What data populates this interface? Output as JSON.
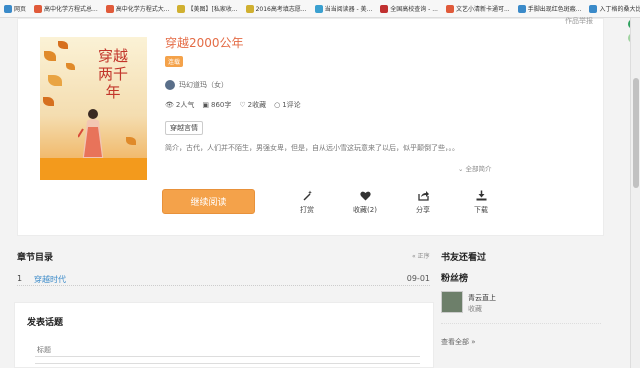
{
  "bookmarks": [
    {
      "label": "网页",
      "color": "#3a8ac9"
    },
    {
      "label": "高中化学方程式总...",
      "color": "#e05a3a"
    },
    {
      "label": "高中化学方程式大...",
      "color": "#e05a3a"
    },
    {
      "label": "【美图】[私家收...",
      "color": "#d0b030"
    },
    {
      "label": "2016高考填志愿...",
      "color": "#d0b030"
    },
    {
      "label": "当当阅读器 - 美...",
      "color": "#3aa0d0"
    },
    {
      "label": "全国高校查询 - ...",
      "color": "#c03030"
    },
    {
      "label": "文艺小清新卡通可...",
      "color": "#e05a3a"
    },
    {
      "label": "手脚出现红色斑瘢...",
      "color": "#3a8ac9"
    },
    {
      "label": "入丁格的桑大比...",
      "color": "#3a8ac9"
    }
  ],
  "book": {
    "report_label": "作品举报",
    "cover_title": "穿越两千年",
    "title": "穿越2000公年",
    "status_tag": "连载",
    "author": "玛幻道玛（女）",
    "popularity": "2人气",
    "word_count": "860字",
    "favorites": "2收藏",
    "comments": "1评论",
    "genre": "穿越言情",
    "intro": "简介，古代，人们并不陌生，男强女卑，但是，自从远小雪这玩意来了以后，似乎颠倒了些，。。",
    "more_intro": "全部简介"
  },
  "actions": {
    "read_label": "继续阅读",
    "tip_label": "打赏",
    "collect_label": "收藏(2)",
    "share_label": "分享",
    "download_label": "下载"
  },
  "chapters": {
    "heading": "章节目录",
    "order_label": "« 正序",
    "items": [
      {
        "num": "1",
        "name": "穿越时代",
        "date": "09-01"
      }
    ]
  },
  "comments": {
    "heading": "发表话题",
    "title_placeholder": "标题"
  },
  "sidebar": {
    "also_read_heading": "书友还看过",
    "fans_heading": "粉丝榜",
    "fans": [
      {
        "name": "青云直上",
        "role": "收藏"
      }
    ],
    "see_all": "查看全部 »"
  }
}
